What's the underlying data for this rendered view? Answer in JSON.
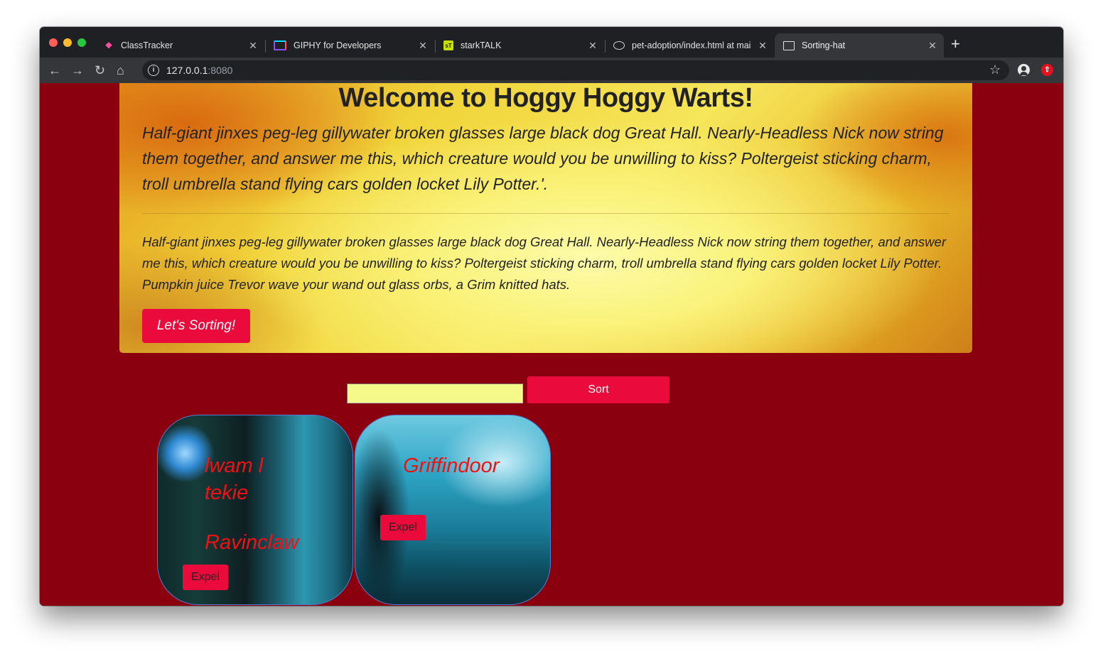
{
  "browser": {
    "tabs": [
      {
        "title": "ClassTracker"
      },
      {
        "title": "GIPHY for Developers"
      },
      {
        "title": "starkTALK"
      },
      {
        "title": "pet-adoption/index.html at mai"
      },
      {
        "title": "Sorting-hat"
      }
    ],
    "address": {
      "host": "127.0.0.1",
      "port": ":8080"
    }
  },
  "jumbotron": {
    "title": "Welcome to Hoggy Hoggy Warts!",
    "lead": "Half-giant jinxes peg-leg gillywater broken glasses large black dog Great Hall. Nearly-Headless Nick now string them together, and answer me this, which creature would you be unwilling to kiss? Poltergeist sticking charm, troll umbrella stand flying cars golden locket Lily Potter.'.",
    "body": "Half-giant jinxes peg-leg gillywater broken glasses large black dog Great Hall. Nearly-Headless Nick now string them together, and answer me this, which creature would you be unwilling to kiss? Poltergeist sticking charm, troll umbrella stand flying cars golden locket Lily Potter. Pumpkin juice Trevor wave your wand out glass orbs, a Grim knitted hats.",
    "button": "Let's Sorting!"
  },
  "form": {
    "input_value": "",
    "sort_button": "Sort"
  },
  "students": [
    {
      "name": "lwam l tekie",
      "house": "Ravinclaw",
      "expel": "Expel"
    },
    {
      "name": "",
      "house": "Griffindoor",
      "expel": "Expel"
    }
  ],
  "colors": {
    "page_bg": "#8b000f",
    "accent": "#ea0a3c",
    "card_text": "#f01212"
  }
}
